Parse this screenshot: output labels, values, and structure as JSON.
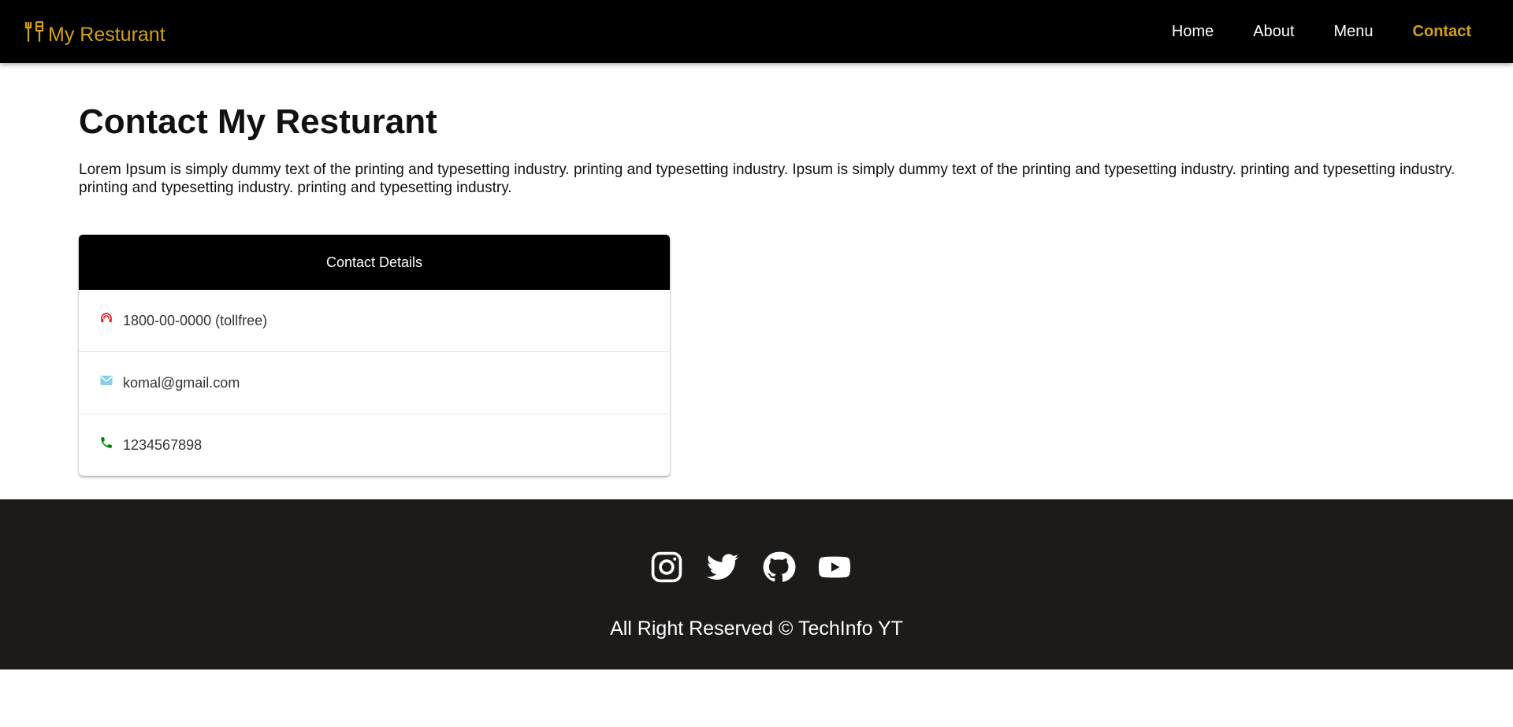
{
  "navbar": {
    "brand_icon": "restaurant-icon",
    "brand_text": "My Resturant",
    "links": [
      "Home",
      "About",
      "Menu",
      "Contact"
    ],
    "active_link": "Contact",
    "accent_color": "#d4a017"
  },
  "main": {
    "title": "Contact My Resturant",
    "intro": "Lorem Ipsum is simply dummy text of the printing and typesetting industry. printing and typesetting industry. Ipsum is simply dummy text of the printing and typesetting industry. printing and typesetting industry. printing and typesetting industry. printing and typesetting industry."
  },
  "contact_card": {
    "header": "Contact Details",
    "rows": [
      {
        "icon": "support-agent-icon",
        "icon_color": "#e02020",
        "text": "1800-00-0000 (tollfree)"
      },
      {
        "icon": "mail-icon",
        "icon_color": "#87ceeb",
        "text": "komal@gmail.com"
      },
      {
        "icon": "phone-icon",
        "icon_color": "#008000",
        "text": "1234567898"
      }
    ]
  },
  "footer": {
    "socials": [
      "instagram-icon",
      "twitter-icon",
      "github-icon",
      "youtube-icon"
    ],
    "copyright": "All Right Reserved © TechInfo YT"
  }
}
